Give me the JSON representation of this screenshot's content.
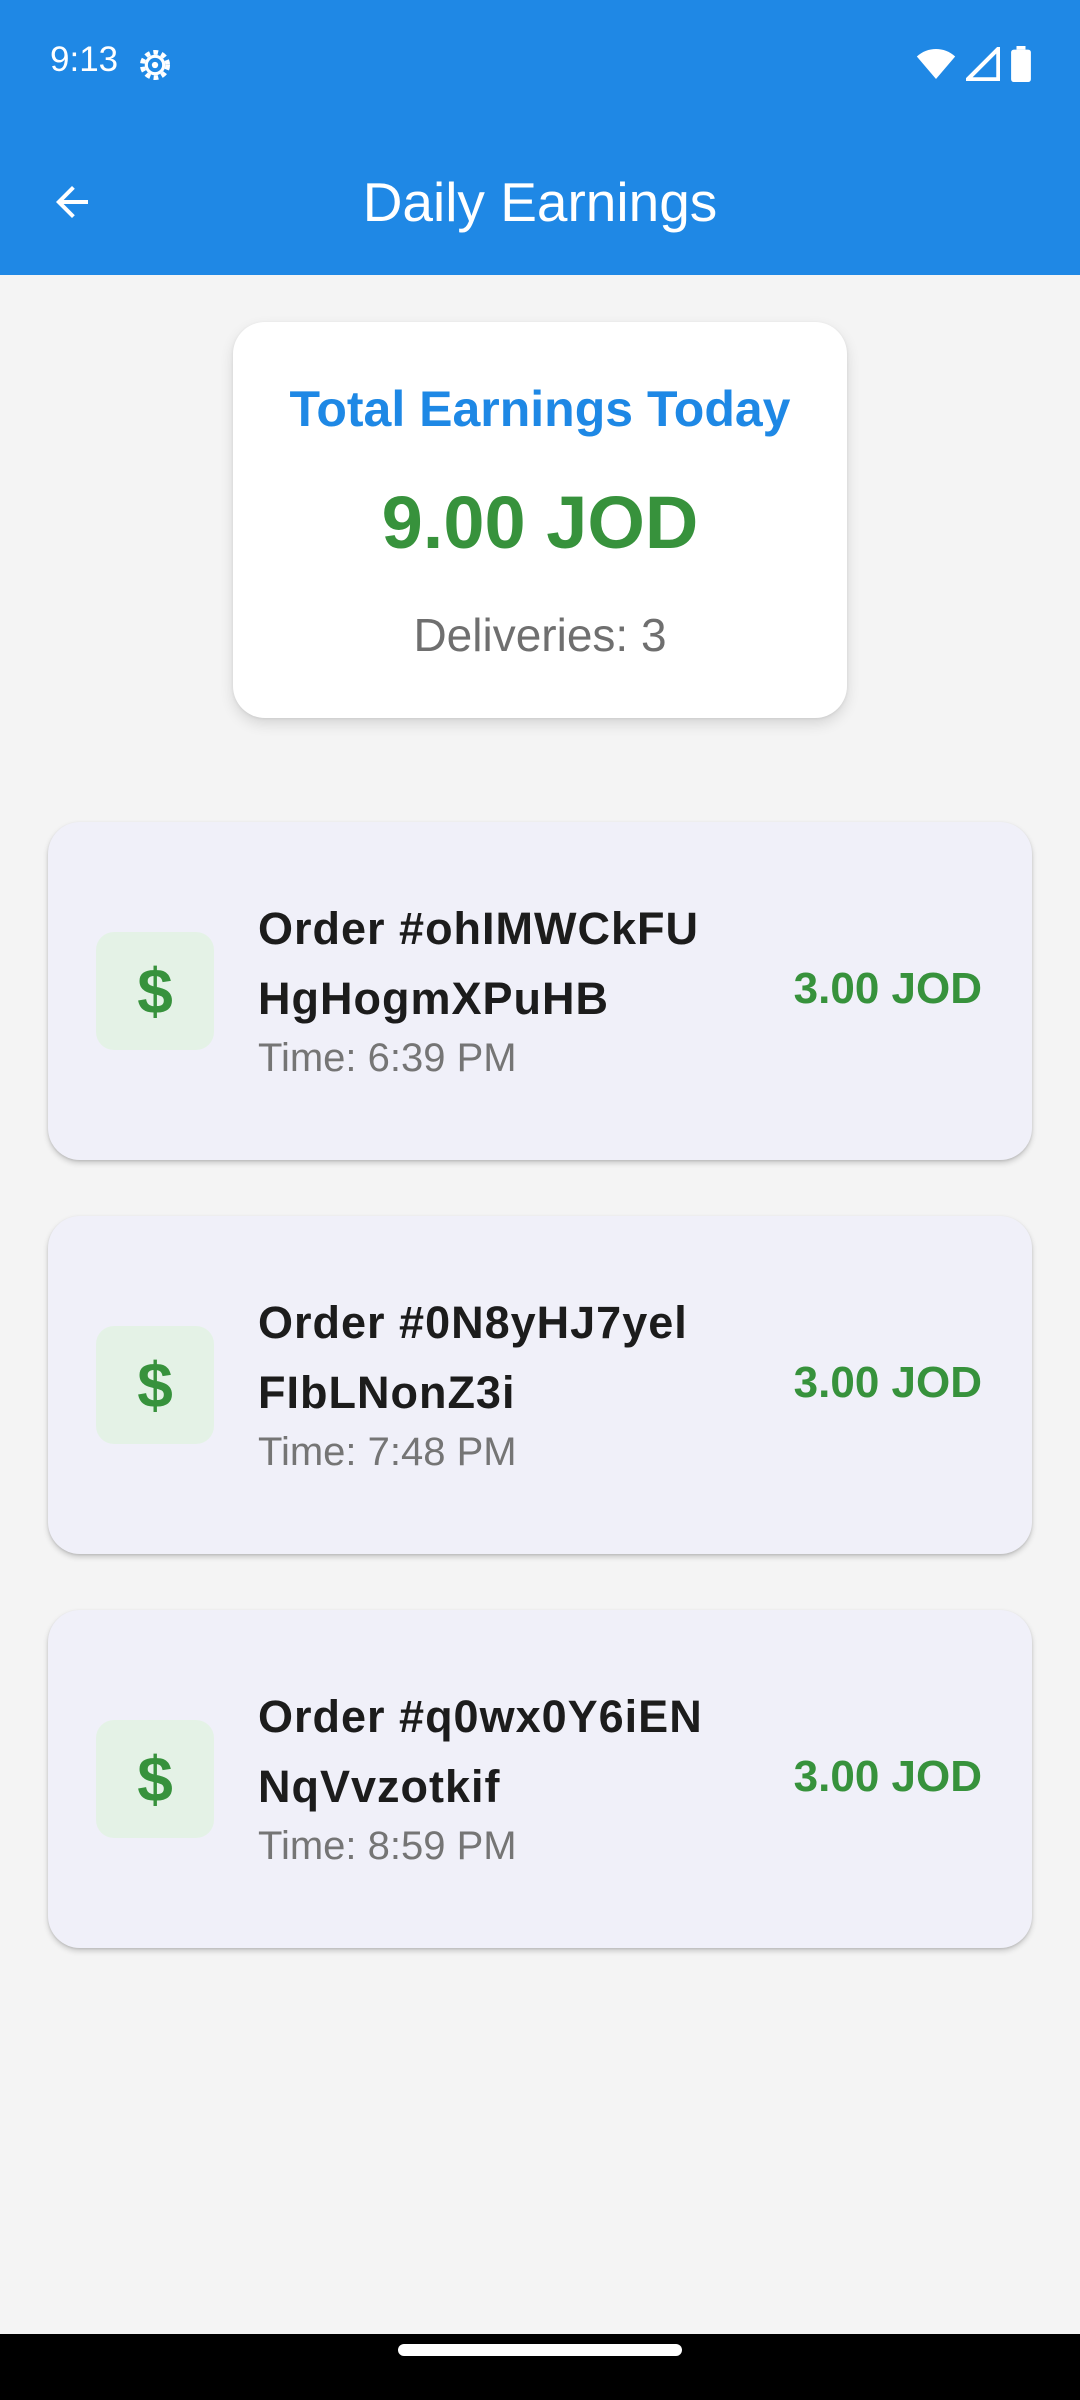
{
  "status_bar": {
    "time": "9:13",
    "icons": [
      "settings-gear-icon",
      "wifi-icon",
      "cellular-signal-icon",
      "battery-icon"
    ]
  },
  "app_bar": {
    "title": "Daily Earnings",
    "back_icon": "arrow-left-icon",
    "color": "#1f88e5"
  },
  "summary": {
    "title": "Total Earnings Today",
    "amount": "9.00 JOD",
    "deliveries": "Deliveries: 3"
  },
  "orders": [
    {
      "title_line1": "Order #ohIMWCkFU",
      "title_line2": "HgHogmXPuHB",
      "time": "Time: 6:39 PM",
      "amount": "3.00 JOD",
      "icon": "dollar-icon"
    },
    {
      "title_line1": "Order #0N8yHJ7yel",
      "title_line2": "FIbLNonZ3i",
      "time": "Time: 7:48 PM",
      "amount": "3.00 JOD",
      "icon": "dollar-icon"
    },
    {
      "title_line1": "Order #q0wx0Y6iEN",
      "title_line2": "NqVvzotkif",
      "time": "Time: 8:59 PM",
      "amount": "3.00 JOD",
      "icon": "dollar-icon"
    }
  ],
  "colors": {
    "primary": "#1f88e5",
    "earnings_green": "#37923c",
    "card_background": "#f0f0f9"
  }
}
